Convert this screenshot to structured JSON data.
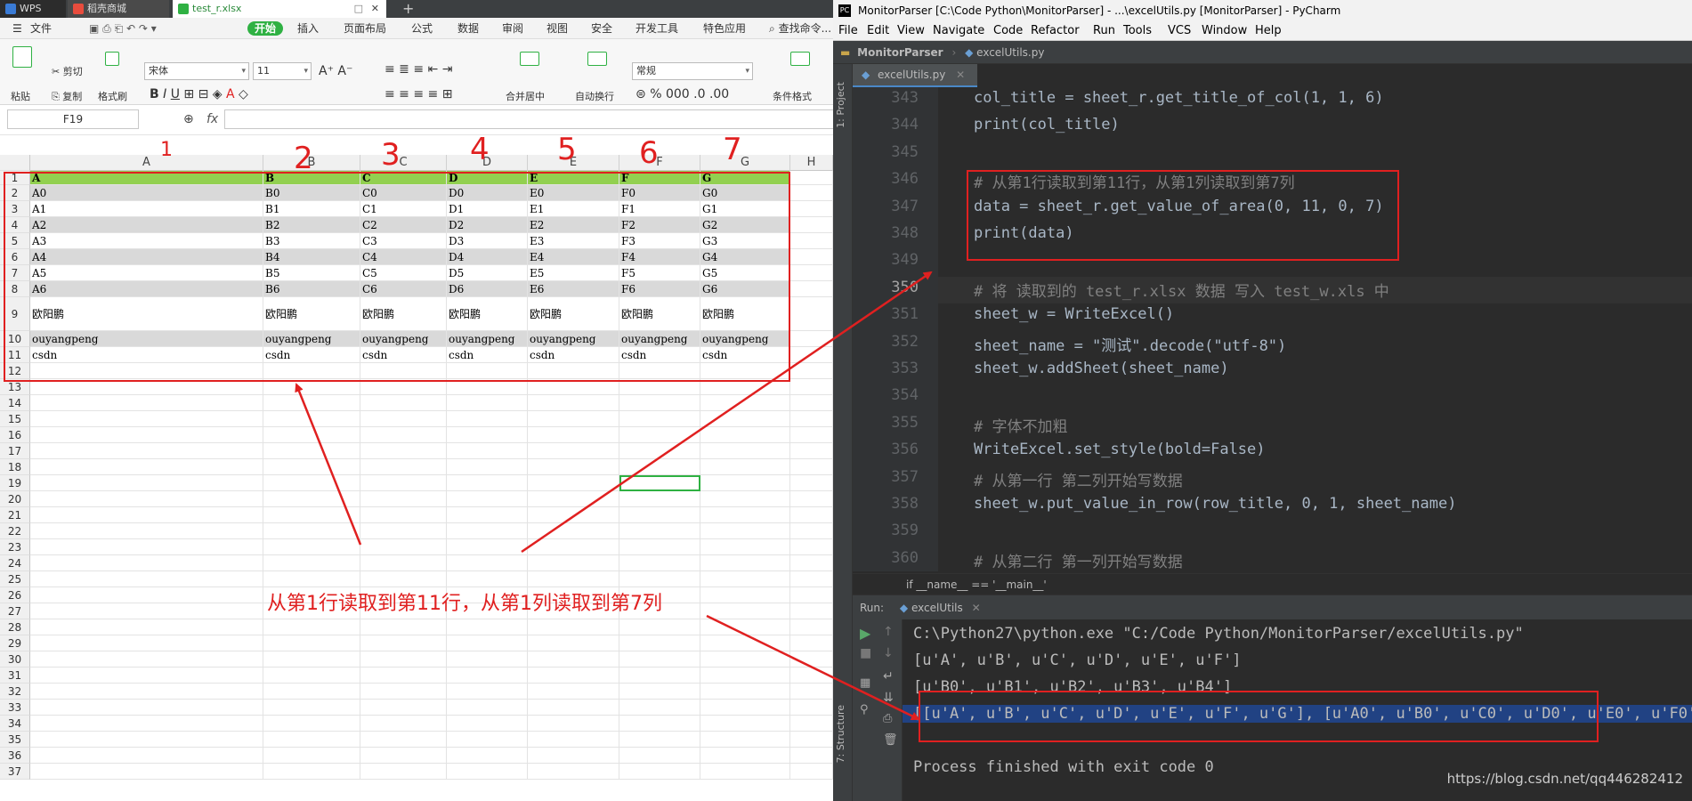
{
  "wps": {
    "tabs": [
      {
        "label": "WPS"
      },
      {
        "label": "稻壳商城"
      },
      {
        "label": "test_r.xlsx"
      }
    ],
    "menu": [
      "文件",
      "开始",
      "插入",
      "页面布局",
      "公式",
      "数据",
      "审阅",
      "视图",
      "安全",
      "开发工具",
      "特色应用",
      "查找命令..."
    ],
    "toolbar": {
      "paste": "粘贴",
      "cut": "剪切",
      "copy": "复制",
      "format_painter": "格式刷",
      "font": "宋体",
      "font_size": "11",
      "merge": "合并居中",
      "wrap": "自动换行",
      "number_format": "常规",
      "cond_format": "条件格式",
      "percent": "%",
      "thousands": "000"
    },
    "name_box": "F19",
    "fx": "fx",
    "columns": [
      "A",
      "B",
      "C",
      "D",
      "E",
      "F",
      "G",
      "H"
    ],
    "rows": [
      [
        "A",
        "B",
        "C",
        "D",
        "E",
        "F",
        "G"
      ],
      [
        "A0",
        "B0",
        "C0",
        "D0",
        "E0",
        "F0",
        "G0"
      ],
      [
        "A1",
        "B1",
        "C1",
        "D1",
        "E1",
        "F1",
        "G1"
      ],
      [
        "A2",
        "B2",
        "C2",
        "D2",
        "E2",
        "F2",
        "G2"
      ],
      [
        "A3",
        "B3",
        "C3",
        "D3",
        "E3",
        "F3",
        "G3"
      ],
      [
        "A4",
        "B4",
        "C4",
        "D4",
        "E4",
        "F4",
        "G4"
      ],
      [
        "A5",
        "B5",
        "C5",
        "D5",
        "E5",
        "F5",
        "G5"
      ],
      [
        "A6",
        "B6",
        "C6",
        "D6",
        "E6",
        "F6",
        "G6"
      ],
      [
        "欧阳鹏",
        "欧阳鹏",
        "欧阳鹏",
        "欧阳鹏",
        "欧阳鹏",
        "欧阳鹏",
        "欧阳鹏"
      ],
      [
        "ouyangpeng",
        "ouyangpeng",
        "ouyangpeng",
        "ouyangpeng",
        "ouyangpeng",
        "ouyangpeng",
        "ouyangpeng"
      ],
      [
        "csdn",
        "csdn",
        "csdn",
        "csdn",
        "csdn",
        "csdn",
        "csdn"
      ]
    ],
    "row_numbers": [
      "1",
      "2",
      "3",
      "4",
      "5",
      "6",
      "7",
      "8",
      "9",
      "10",
      "11",
      "12",
      "13",
      "14",
      "15",
      "16",
      "17",
      "18",
      "19",
      "20",
      "21",
      "22",
      "23",
      "24",
      "25",
      "26",
      "27",
      "28",
      "29",
      "30",
      "31",
      "32",
      "33",
      "34",
      "35",
      "36",
      "37"
    ]
  },
  "pycharm": {
    "title": "MonitorParser [C:\\Code Python\\MonitorParser] - ...\\excelUtils.py [MonitorParser] - PyCharm",
    "menu": [
      "File",
      "Edit",
      "View",
      "Navigate",
      "Code",
      "Refactor",
      "Run",
      "Tools",
      "VCS",
      "Window",
      "Help"
    ],
    "nav": {
      "project": "MonitorParser",
      "file": "excelUtils.py"
    },
    "editor_tab": "excelUtils.py",
    "side_labels": {
      "project": "1: Project",
      "structure": "7: Structure"
    },
    "lines": [
      {
        "n": "343",
        "code": "col_title = sheet_r.get_title_of_col(1, 1, 6)"
      },
      {
        "n": "344",
        "code": "print(col_title)"
      },
      {
        "n": "345",
        "code": ""
      },
      {
        "n": "346",
        "code": "# 从第1行读取到第11行，从第1列读取到第7列"
      },
      {
        "n": "347",
        "code": "data = sheet_r.get_value_of_area(0, 11, 0, 7)"
      },
      {
        "n": "348",
        "code": "print(data)"
      },
      {
        "n": "349",
        "code": ""
      },
      {
        "n": "350",
        "code": "# 将 读取到的 test_r.xlsx 数据 写入 test_w.xls 中"
      },
      {
        "n": "351",
        "code": "sheet_w = WriteExcel()"
      },
      {
        "n": "352",
        "code": "sheet_name = \"测试\".decode(\"utf-8\")"
      },
      {
        "n": "353",
        "code": "sheet_w.addSheet(sheet_name)"
      },
      {
        "n": "354",
        "code": ""
      },
      {
        "n": "355",
        "code": "# 字体不加粗"
      },
      {
        "n": "356",
        "code": "WriteExcel.set_style(bold=False)"
      },
      {
        "n": "357",
        "code": "# 从第一行 第二列开始写数据"
      },
      {
        "n": "358",
        "code": "sheet_w.put_value_in_row(row_title, 0, 1, sheet_name)"
      },
      {
        "n": "359",
        "code": ""
      },
      {
        "n": "360",
        "code": "# 从第二行 第一列开始写数据"
      }
    ],
    "breadcrumb": "if __name__ == '__main__'",
    "run_label": "Run:",
    "run_tab": "excelUtils",
    "console": [
      "C:\\Python27\\python.exe \"C:/Code Python/MonitorParser/excelUtils.py\"",
      "[u'A', u'B', u'C', u'D', u'E', u'F']",
      "[u'B0', u'B1', u'B2', u'B3', u'B4']",
      "[[u'A', u'B', u'C', u'D', u'E', u'F', u'G'], [u'A0', u'B0', u'C0', u'D0', u'E0', u'F0',",
      "",
      "Process finished with exit code 0"
    ]
  },
  "annotation": {
    "text": "从第1行读取到第11行，从第1列读取到第7列",
    "column_numbers": [
      "1",
      "2",
      "3",
      "4",
      "5",
      "6",
      "7"
    ]
  },
  "watermark": "https://blog.csdn.net/qq446282412"
}
